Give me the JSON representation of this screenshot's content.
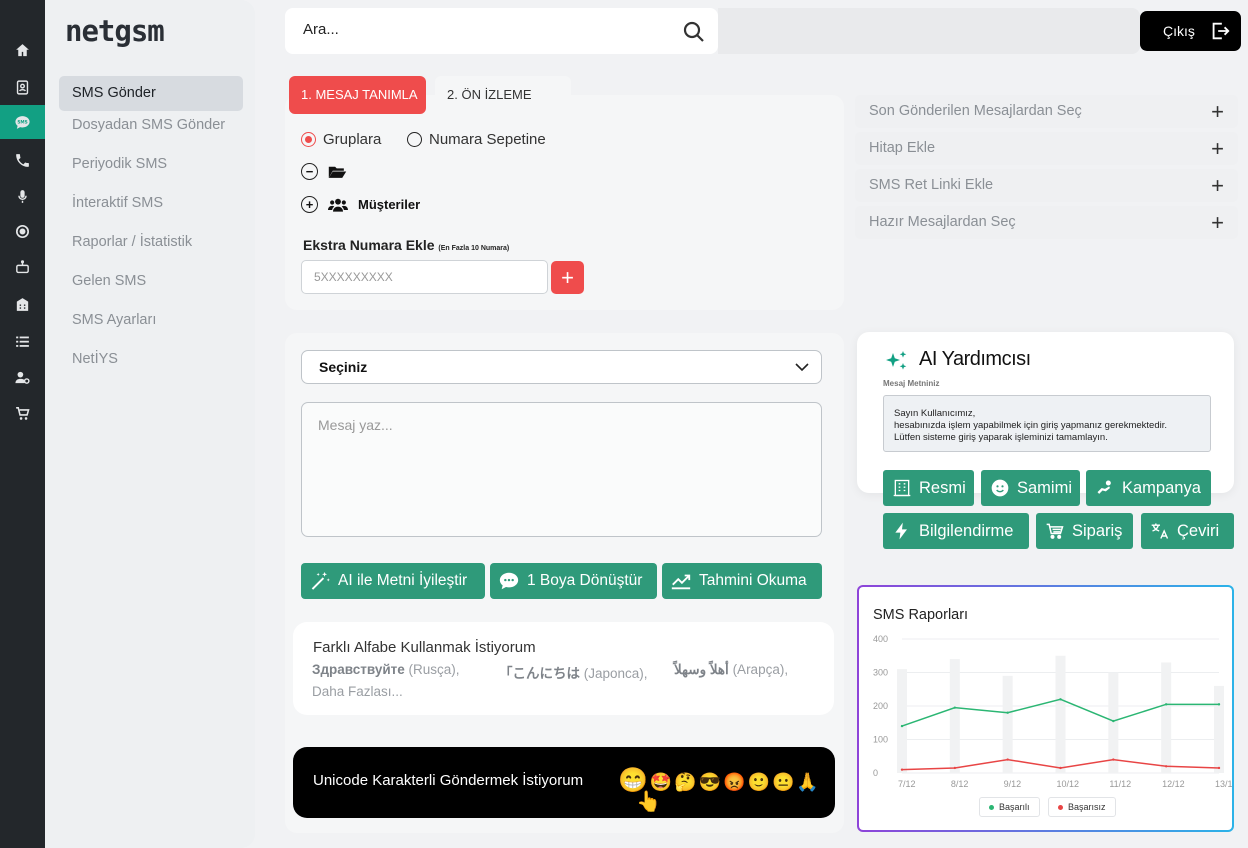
{
  "brand": "netgsm",
  "colors": {
    "accent_green": "#2f9a7a",
    "active_rail": "#12a083",
    "accent_red": "#ef4c4c"
  },
  "rail_icons": [
    "home-icon",
    "contact-book-icon",
    "sms-icon",
    "phone-icon",
    "microphone-icon",
    "operator-icon",
    "robot-icon",
    "building-icon",
    "list-icon",
    "user-settings-icon",
    "cart-icon"
  ],
  "sidebar": {
    "items": [
      {
        "label": "SMS Gönder",
        "active": true
      },
      {
        "label": "Dosyadan SMS Gönder"
      },
      {
        "label": "Periyodik SMS"
      },
      {
        "label": "İnteraktif SMS"
      },
      {
        "label": "Raporlar / İstatistik"
      },
      {
        "label": "Gelen SMS"
      },
      {
        "label": "SMS Ayarları"
      },
      {
        "label": "NetİYS"
      }
    ]
  },
  "search": {
    "placeholder": "Ara..."
  },
  "logout": {
    "label": "Çıkış"
  },
  "tabs": {
    "tab1": "1. MESAJ TANIMLA",
    "tab2": "2. ÖN İZLEME"
  },
  "recipients": {
    "option_groups": "Gruplara",
    "option_basket": "Numara Sepetine",
    "group_customers": "Müşteriler",
    "extra_label": "Ekstra Numara Ekle",
    "extra_note": "(En Fazla 10 Numara)",
    "phone_placeholder": "5XXXXXXXXX"
  },
  "accordion": [
    "Son Gönderilen Mesajlardan Seç",
    "Hitap Ekle",
    "SMS Ret Linki Ekle",
    "Hazır Mesajlardan Seç"
  ],
  "composer": {
    "select_value": "Seçiniz",
    "message_placeholder": "Mesaj yaz...",
    "btn_ai": "AI ile Metni İyileştir",
    "btn_boy": "1 Boya Dönüştür",
    "btn_read": "Tahmini Okuma"
  },
  "alphabet": {
    "title": "Farklı Alfabe Kullanmak İstiyorum",
    "ru_word": "Здравствуйте",
    "ru_name": "(Rusça),",
    "jp_word": "「こんにちは",
    "jp_name": "(Japonca),",
    "ar_word": "أهلاً وسهلاً",
    "ar_name": "(Arapça),",
    "more": "Daha Fazlası..."
  },
  "unicode": {
    "label": "Unicode Karakterli Göndermek İstiyorum",
    "emoji_big": "😁",
    "emojis": "🤩🤔😎😡🙂😐🙏",
    "hand": "👆"
  },
  "ai": {
    "title": "AI Yardımcısı",
    "label": "Mesaj Metniniz",
    "line1": "Sayın Kullanıcımız,",
    "line2": "hesabınızda işlem yapabilmek için giriş yapmanız gerekmektedir.",
    "line3": "Lütfen sisteme giriş yaparak işleminizi tamamlayın.",
    "tones": [
      "Resmi",
      "Samimi",
      "Kampanya",
      "Bilgilendirme",
      "Sipariş",
      "Çeviri"
    ]
  },
  "chart_data": {
    "type": "line",
    "title": "SMS Raporları",
    "categories": [
      "7/12",
      "8/12",
      "9/12",
      "10/12",
      "11/12",
      "12/12",
      "13/12"
    ],
    "ylim": [
      0,
      400
    ],
    "yticks": [
      0,
      100,
      200,
      300,
      400
    ],
    "grid": true,
    "legend_position": "bottom",
    "bars": [
      310,
      340,
      290,
      350,
      300,
      330,
      260
    ],
    "series": [
      {
        "name": "Başarılı",
        "color": "#2bb673",
        "values": [
          140,
          195,
          180,
          220,
          155,
          205,
          205
        ]
      },
      {
        "name": "Başarısız",
        "color": "#e84545",
        "values": [
          10,
          15,
          40,
          15,
          40,
          20,
          15
        ]
      }
    ]
  }
}
